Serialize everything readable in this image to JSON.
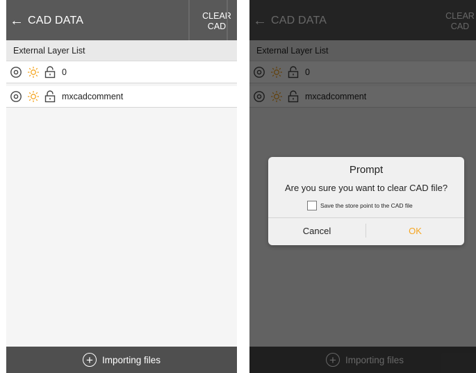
{
  "colors": {
    "topbar": "#595959",
    "bottombar": "#4f4f4f",
    "accent_ok": "#f5a623",
    "sun_icon": "#f5a623",
    "section_header_bg": "#e9e9e9"
  },
  "header": {
    "title": "CAD DATA",
    "back_icon": "arrow-left-icon",
    "clear_line1": "CLEAR",
    "clear_line2": "CAD"
  },
  "section": {
    "label": "External Layer List"
  },
  "layers": [
    {
      "name": "0",
      "icons": [
        "eye-icon",
        "sun-icon",
        "unlock-icon"
      ]
    },
    {
      "name": "mxcadcomment",
      "icons": [
        "eye-icon",
        "sun-icon",
        "unlock-icon"
      ]
    }
  ],
  "footer": {
    "label": "Importing files",
    "icon": "plus-circle-icon"
  },
  "dialog": {
    "title": "Prompt",
    "message": "Are you sure you want to clear CAD file?",
    "checkbox_label": "Save the store point to the CAD file",
    "checkbox_checked": false,
    "cancel": "Cancel",
    "ok": "OK"
  }
}
